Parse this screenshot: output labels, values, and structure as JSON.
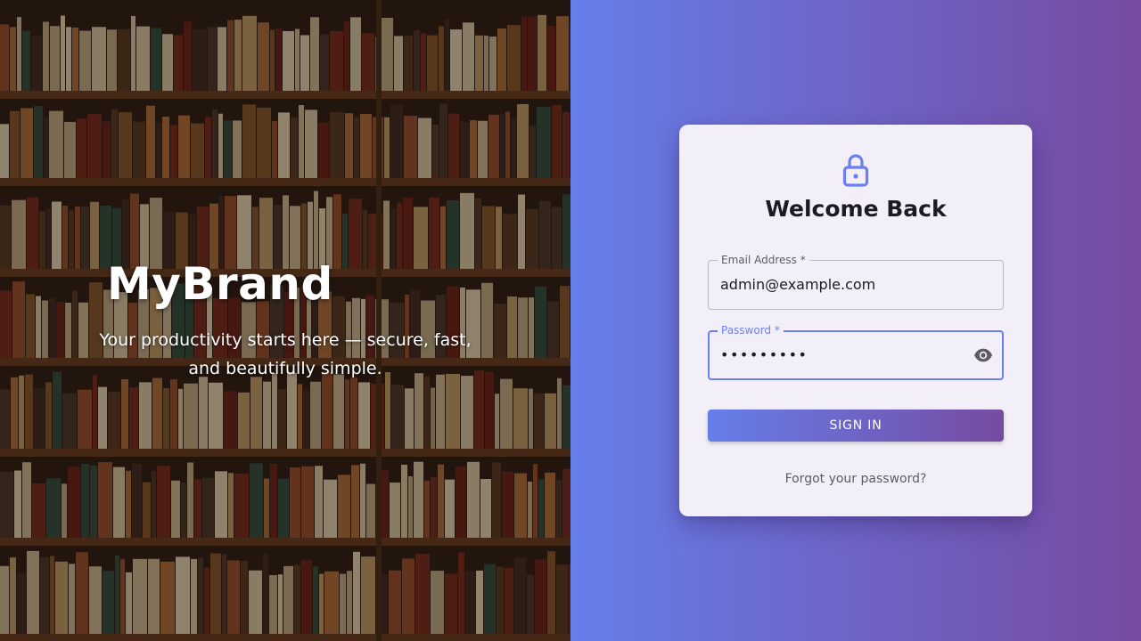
{
  "hero": {
    "brand": "MyBrand",
    "tagline": "Your productivity starts here — secure, fast, and beautifully simple."
  },
  "login": {
    "icon": "lock-icon",
    "title": "Welcome Back",
    "email": {
      "label": "Email Address *",
      "value": "admin@example.com"
    },
    "password": {
      "label": "Password *",
      "value": "•••••••••",
      "toggle_icon": "eye-icon"
    },
    "submit_label": "SIGN IN",
    "forgot_label": "Forgot your password?"
  },
  "colors": {
    "gradient_start": "#667eea",
    "gradient_end": "#764ba2",
    "card_bg": "#f2eff8",
    "accent": "#6b7ff0"
  }
}
